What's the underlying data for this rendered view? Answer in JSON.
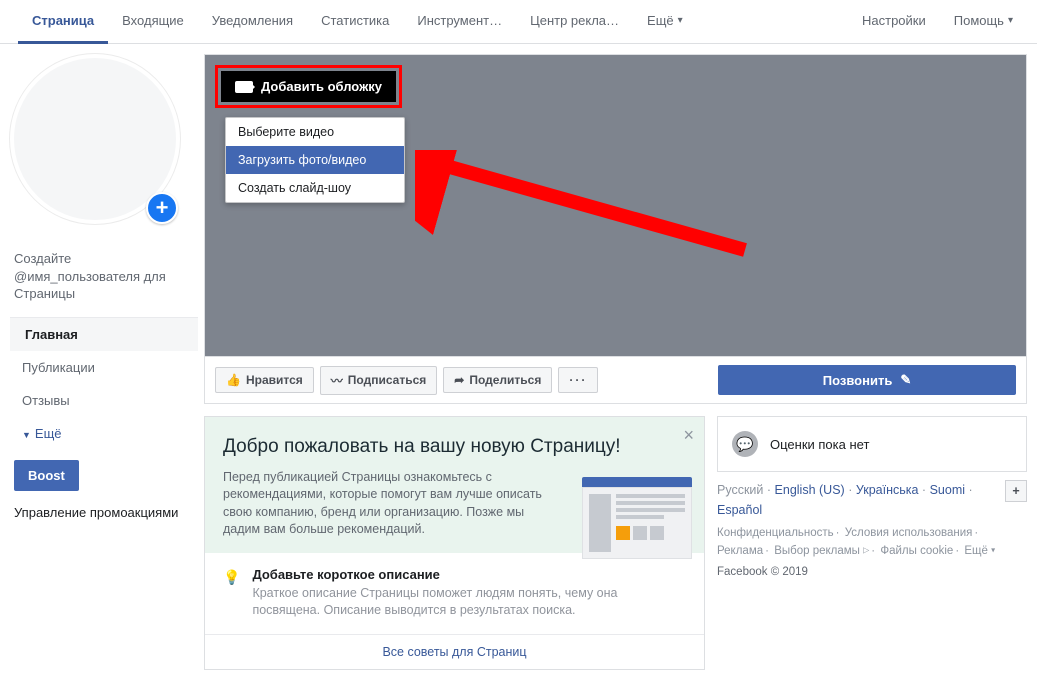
{
  "topnav": {
    "tabs": [
      "Страница",
      "Входящие",
      "Уведомления",
      "Статистика",
      "Инструмент…",
      "Центр рекла…",
      "Ещё"
    ],
    "right": [
      "Настройки",
      "Помощь"
    ]
  },
  "left": {
    "username_hint": "Создайте @имя_пользователя для Страницы",
    "nav": {
      "home": "Главная",
      "posts": "Публикации",
      "reviews": "Отзывы",
      "more": "Ещё"
    },
    "boost": "Boost",
    "promo": "Управление промоакциями"
  },
  "cover": {
    "add_label": "Добавить обложку",
    "menu": {
      "choose_video": "Выберите видео",
      "upload": "Загрузить фото/видео",
      "slideshow": "Создать слайд-шоу"
    }
  },
  "actions": {
    "like": "Нравится",
    "follow": "Подписаться",
    "share": "Поделиться",
    "call": "Позвонить"
  },
  "welcome": {
    "title": "Добро пожаловать на вашу новую Страницу!",
    "desc": "Перед публикацией Страницы ознакомьтесь с рекомендациями, которые помогут вам лучше описать свою компанию, бренд или организацию. Позже мы дадим вам больше рекомендаций.",
    "tip_title": "Добавьте короткое описание",
    "tip_desc": "Краткое описание Страницы поможет людям понять, чему она посвящена. Описание выводится в результатах поиска.",
    "all_tips": "Все советы для Страниц"
  },
  "sidebar": {
    "ratings": "Оценки пока нет",
    "langs": {
      "ru": "Русский",
      "en": "English (US)",
      "uk": "Українська",
      "fi": "Suomi",
      "es": "Español"
    },
    "footer": {
      "privacy": "Конфиденциальность",
      "terms": "Условия использования",
      "ads": "Реклама",
      "adchoices": "Выбор рекламы",
      "cookies": "Файлы cookie",
      "more": "Ещё",
      "copyright": "Facebook © 2019"
    }
  }
}
